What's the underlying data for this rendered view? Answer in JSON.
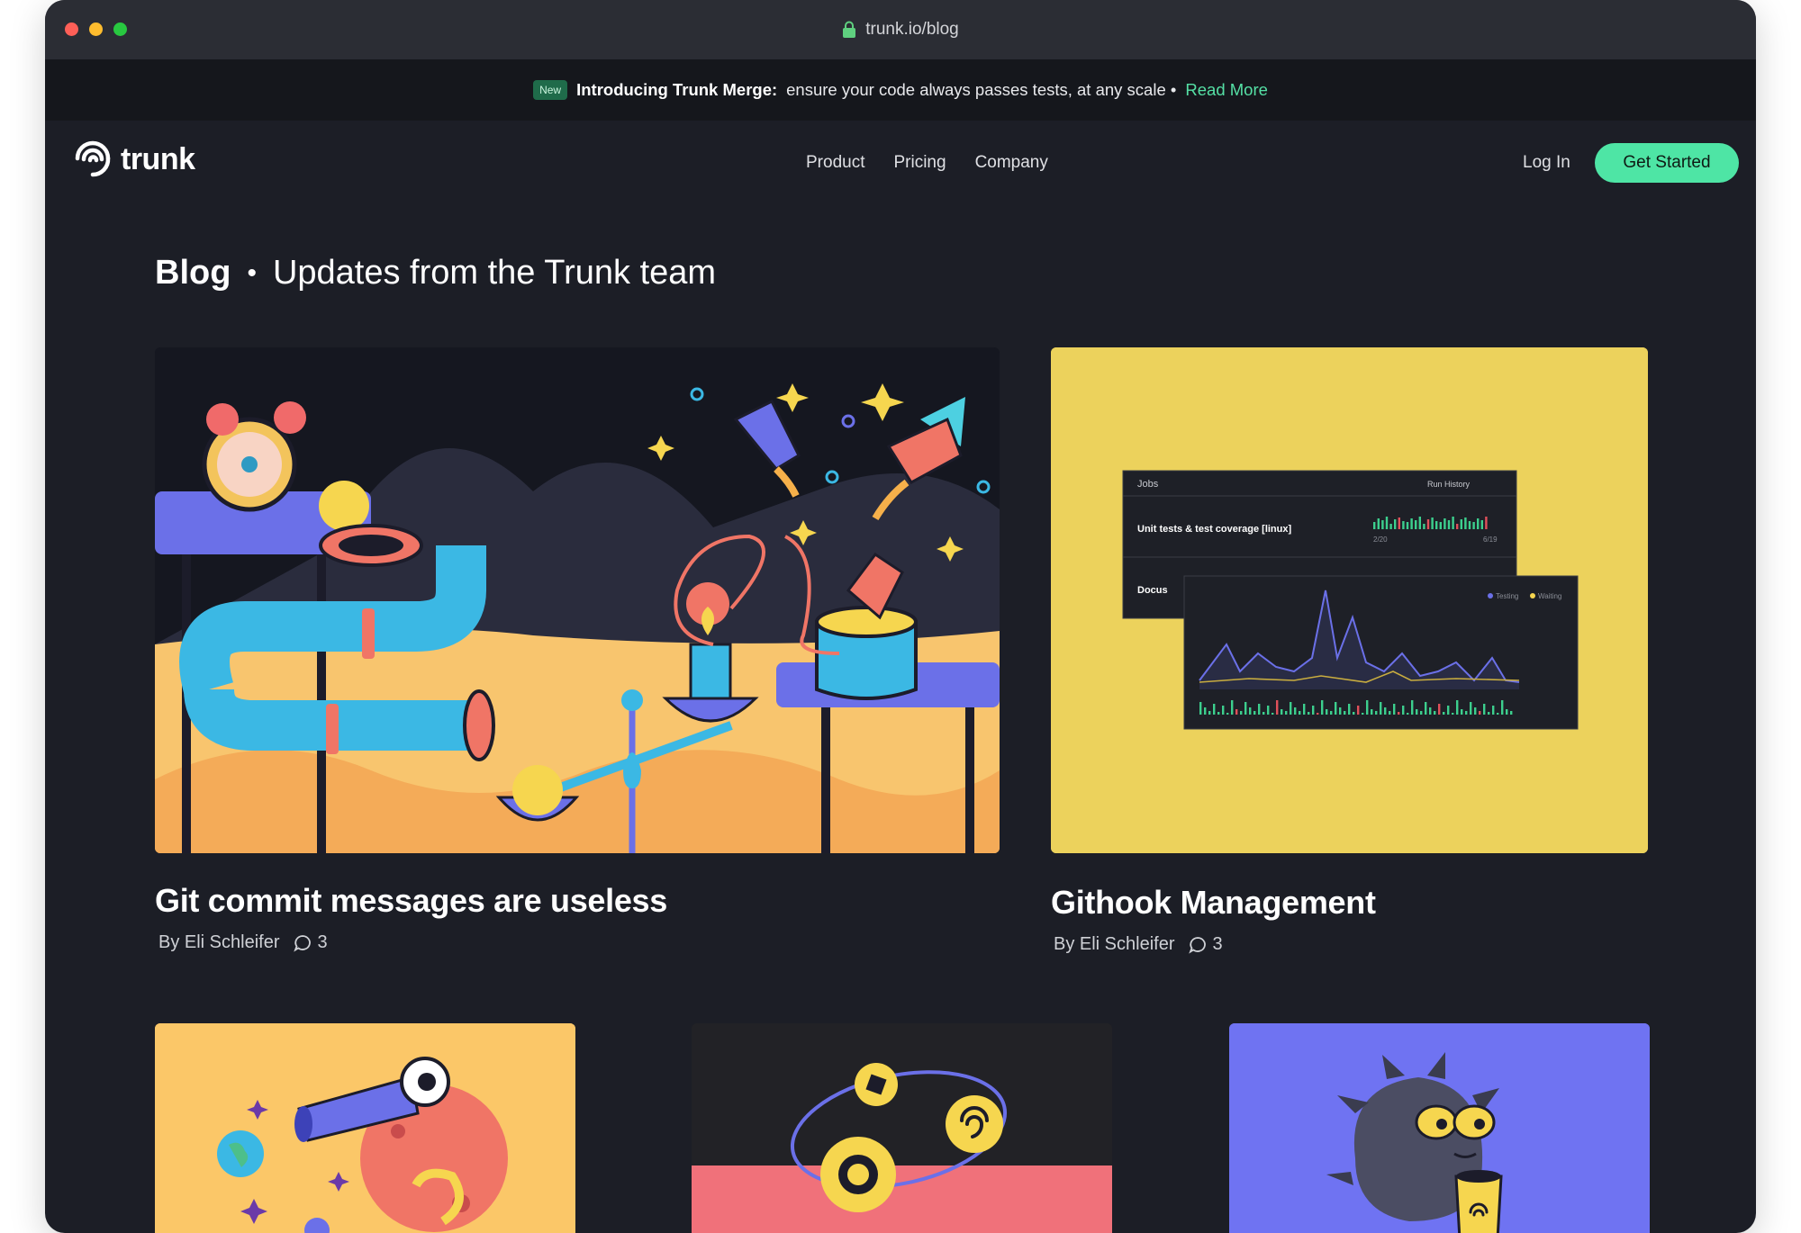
{
  "browser": {
    "url": "trunk.io/blog"
  },
  "banner": {
    "badge": "New",
    "headline": "Introducing Trunk Merge:",
    "text": "ensure your code always passes tests, at any scale •",
    "link": "Read More"
  },
  "nav": {
    "logo_text": "trunk",
    "items": [
      "Product",
      "Pricing",
      "Company"
    ],
    "login": "Log In",
    "cta": "Get Started"
  },
  "page": {
    "title": "Blog",
    "separator": "•",
    "subtitle": "Updates from the Trunk team"
  },
  "posts": [
    {
      "title": "Git commit messages are useless",
      "author": "By Eli Schleifer",
      "comments": "3"
    },
    {
      "title": "Githook Management",
      "author": "By Eli Schleifer",
      "comments": "3"
    }
  ],
  "dashboard": {
    "jobs_header": "Jobs",
    "run_history": "Run History",
    "job1": "Unit tests & test coverage [linux]",
    "date_start": "2/20",
    "date_end": "6/19",
    "job2": "Docus",
    "legend_testing": "Testing",
    "legend_waiting": "Waiting"
  },
  "colors": {
    "background": "#1c1e26",
    "accent": "#4ee5a5",
    "banner_link": "#55e0a5"
  }
}
